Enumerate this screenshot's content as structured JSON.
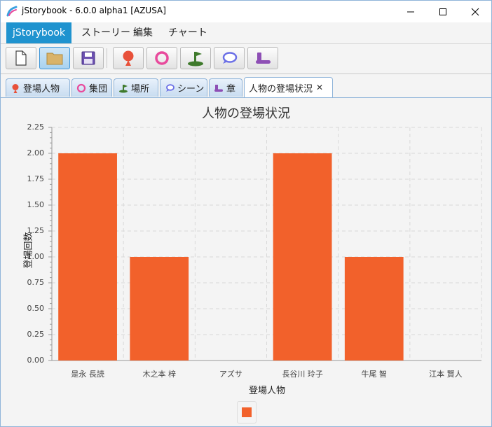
{
  "window": {
    "title": "jStorybook - 6.0.0 alpha1 [AZUSA]",
    "minimize_icon": "minimize-icon",
    "maximize_icon": "maximize-icon",
    "close_icon": "close-icon"
  },
  "menu": {
    "items": [
      {
        "label": "jStorybook"
      },
      {
        "label": "ストーリー"
      },
      {
        "label": "編集"
      },
      {
        "label": "チャート"
      }
    ]
  },
  "toolbar": {
    "buttons": [
      {
        "icon": "new-file-icon"
      },
      {
        "icon": "open-folder-icon"
      },
      {
        "icon": "save-icon"
      },
      {
        "icon": "person-icon"
      },
      {
        "icon": "group-ring-icon"
      },
      {
        "icon": "place-flag-icon"
      },
      {
        "icon": "scene-bubble-icon"
      },
      {
        "icon": "chapter-icon"
      }
    ]
  },
  "tabs": [
    {
      "label": "登場人物",
      "icon": "person-icon"
    },
    {
      "label": "集団",
      "icon": "group-ring-icon"
    },
    {
      "label": "場所",
      "icon": "place-flag-icon"
    },
    {
      "label": "シーン",
      "icon": "scene-bubble-icon"
    },
    {
      "label": "章",
      "icon": "chapter-icon"
    },
    {
      "label": "人物の登場状況",
      "close": "✕"
    }
  ],
  "colors": {
    "accent": "#1f93cf",
    "bar": "#f2612b",
    "person": "#e8513a",
    "group": "#e84a9c",
    "place": "#3f7a2c",
    "scene": "#6b6fe6",
    "chapter": "#8e4fb5"
  },
  "chart_data": {
    "type": "bar",
    "title": "人物の登場状況",
    "xlabel": "登場人物",
    "ylabel": "登場回数",
    "categories": [
      "是永 長読",
      "木之本 梓",
      "アズサ",
      "長谷川 玲子",
      "牛尾 智",
      "江本 賢人"
    ],
    "values": [
      2,
      1,
      0,
      2,
      1,
      0
    ],
    "ylim": [
      0,
      2.25
    ],
    "yticks": [
      "0.00",
      "0.25",
      "0.50",
      "0.75",
      "1.00",
      "1.25",
      "1.50",
      "1.75",
      "2.00",
      "2.25"
    ],
    "grid": true,
    "legend": "bottom"
  }
}
